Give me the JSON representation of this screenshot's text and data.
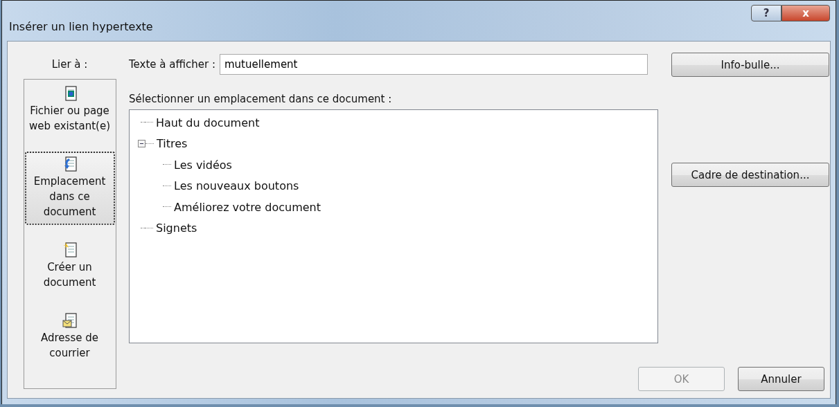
{
  "window": {
    "title": "Insérer un lien hypertexte",
    "help_button": "?",
    "close_button": "x"
  },
  "link_to": {
    "label": "Lier à :",
    "items": [
      {
        "label": "Fichier ou page web existant(e)",
        "kind": "file",
        "selected": false
      },
      {
        "label": "Emplacement dans ce document",
        "kind": "place",
        "selected": true
      },
      {
        "label": "Créer un document",
        "kind": "new",
        "selected": false
      },
      {
        "label": "Adresse de courrier",
        "kind": "mail",
        "selected": false
      }
    ]
  },
  "display_text": {
    "label": "Texte à afficher :",
    "value": "mutuellement"
  },
  "tooltip_button": "Info-bulle...",
  "tree": {
    "label": "Sélectionner un emplacement dans ce document :",
    "items": [
      {
        "label": "Haut du document"
      },
      {
        "label": "Titres",
        "expanded": true,
        "children": [
          {
            "label": "Les vidéos"
          },
          {
            "label": "Les nouveaux boutons"
          },
          {
            "label": "Améliorez votre document"
          }
        ]
      },
      {
        "label": "Signets"
      }
    ]
  },
  "target_frame_button": "Cadre de destination...",
  "buttons": [
    {
      "label": "OK",
      "disabled": true
    },
    {
      "label": "Annuler",
      "disabled": false
    }
  ]
}
